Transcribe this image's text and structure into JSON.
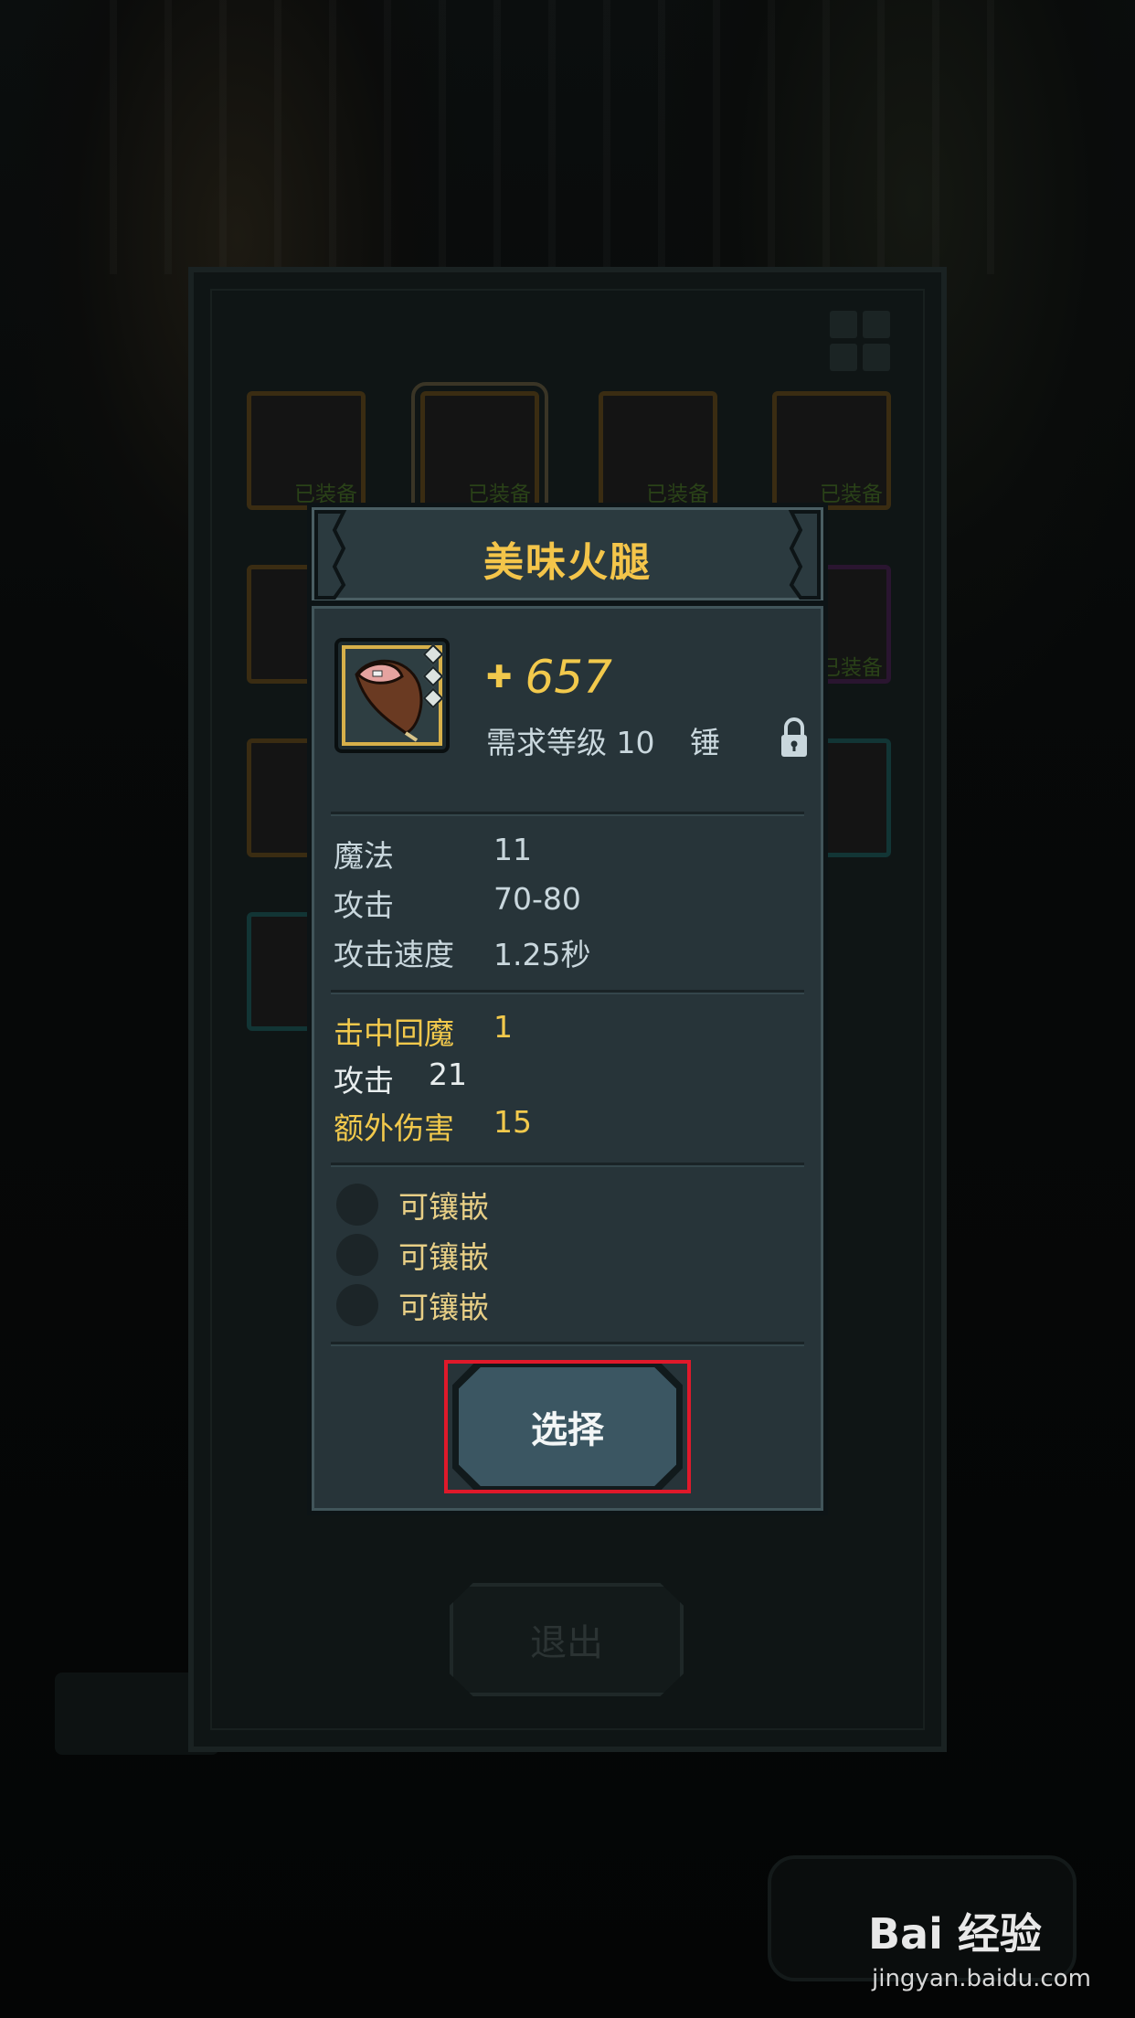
{
  "background": {
    "slot_equipped_label": "已装备",
    "exit_button_label": "退出"
  },
  "dialog": {
    "title": "美味火腿",
    "price": "657",
    "requirement": "需求等级 10",
    "weapon_type": "锤",
    "base_stats": [
      {
        "label": "魔法",
        "value": "11"
      },
      {
        "label": "攻击",
        "value": "70-80"
      },
      {
        "label": "攻击速度",
        "value": "1.25秒"
      }
    ],
    "bonus_stats": [
      {
        "label": "击中回魔",
        "value": "1"
      },
      {
        "label": "攻击",
        "value": "21"
      },
      {
        "label": "额外伤害",
        "value": "15"
      }
    ],
    "sockets": [
      "可镶嵌",
      "可镶嵌",
      "可镶嵌"
    ],
    "select_button": "选择"
  },
  "watermark": {
    "logo": "Bai 经验",
    "url": "jingyan.baidu.com"
  },
  "colors": {
    "title_gold": "#f4c54a",
    "panel": "#273439",
    "highlight_red": "#e0192a"
  },
  "icons": [
    "ham-item-icon",
    "price-icon",
    "lock-icon",
    "grid-view-icon"
  ]
}
